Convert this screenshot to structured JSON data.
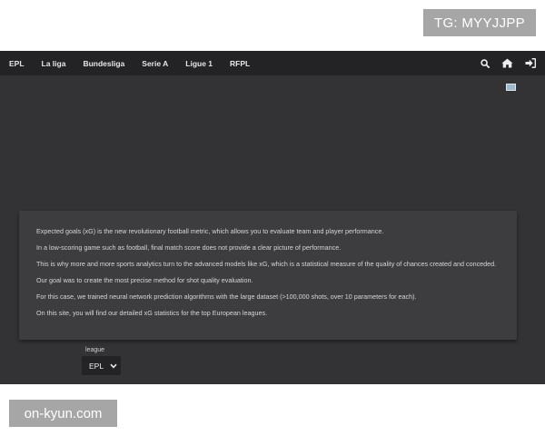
{
  "watermarks": {
    "telegram": "TG: MYYJJPP",
    "site": "on-kyun.com"
  },
  "nav": {
    "links": [
      "EPL",
      "La liga",
      "Bundesliga",
      "Serie A",
      "Ligue 1",
      "RFPL"
    ],
    "icons": [
      "search-icon",
      "home-icon",
      "sign-in-icon"
    ]
  },
  "intro": {
    "paragraphs": [
      "Expected goals (xG) is the new revolutionary football metric, which allows you to evaluate team and player performance.",
      "In a low-scoring game such as football, final match score does not provide a clear picture of performance.",
      "This is why more and more sports analytics turn to the advanced models like xG, which is a statistical measure of the quality of chances created and conceded.",
      "Our goal was to create the most precise method for shot quality evaluation.",
      "For this case, we trained neural network prediction algorithms with the large dataset (>100,000 shots, over 10 parameters for each).",
      "On this site, you will find our detailed xG statistics for the top European leagues."
    ]
  },
  "league_filter": {
    "label": "league",
    "selected": "EPL"
  },
  "colors": {
    "page_bg": "#333335",
    "navbar_bg": "#232325",
    "card_bg": "#3d3d3f",
    "text": "#d6d6d6",
    "badge_bg": "#a6a6a6"
  }
}
